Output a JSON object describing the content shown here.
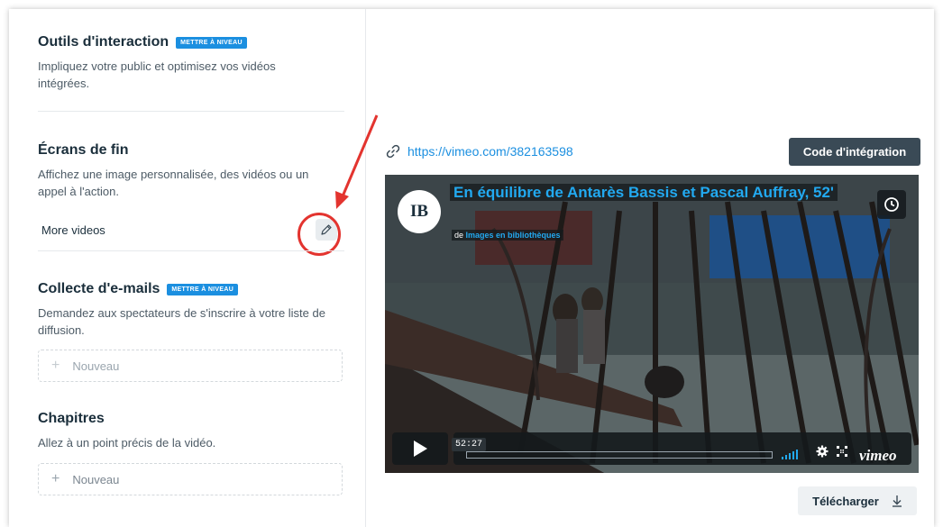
{
  "interaction_tools": {
    "title": "Outils d'interaction",
    "badge": "METTRE À NIVEAU",
    "description": "Impliquez votre public et optimisez vos vidéos intégrées."
  },
  "end_screens": {
    "title": "Écrans de fin",
    "description": "Affichez une image personnalisée, des vidéos ou un appel à l'action.",
    "current_value": "More videos",
    "edit_icon": "pencil-icon"
  },
  "email_capture": {
    "title": "Collecte d'e-mails",
    "badge": "METTRE À NIVEAU",
    "description": "Demandez aux spectateurs de s'inscrire à votre liste de diffusion.",
    "new_label": "Nouveau"
  },
  "chapters": {
    "title": "Chapitres",
    "description": "Allez à un point précis de la vidéo.",
    "new_label": "Nouveau"
  },
  "share": {
    "link_icon": "link-icon",
    "url": "https://vimeo.com/382163598",
    "embed_label": "Code d'intégration"
  },
  "player": {
    "logo_text": "IB",
    "title": "En équilibre de Antarès Bassis et Pascal Auffray, 52'",
    "byline_prefix": "de",
    "byline_channel": "Images en bibliothèques",
    "timecode": "52:27",
    "brand": "vimeo",
    "progress": 0.0
  },
  "download": {
    "label": "Télécharger",
    "icon": "download-icon"
  },
  "colors": {
    "accent": "#1b8fe0",
    "annotation": "#e3342f",
    "dark_button": "#3a4a56"
  }
}
